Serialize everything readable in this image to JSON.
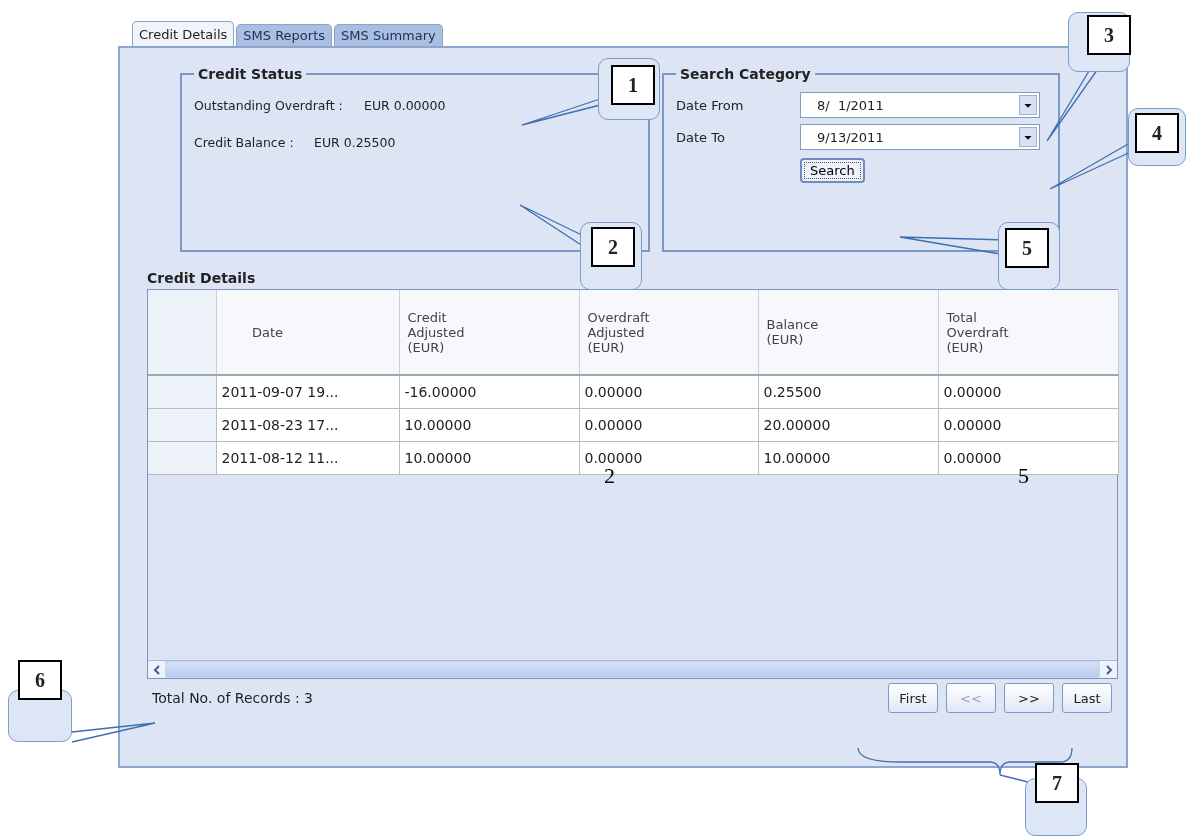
{
  "tabs": [
    {
      "label": "Credit Details",
      "selected": true
    },
    {
      "label": "SMS Reports",
      "selected": false
    },
    {
      "label": "SMS Summary",
      "selected": false
    }
  ],
  "credit_status": {
    "title": "Credit Status",
    "fields": [
      {
        "label": "Outstanding Overdraft :",
        "value": "EUR 0.00000"
      },
      {
        "label": "Credit Balance :",
        "value": "EUR 0.25500"
      }
    ]
  },
  "search_category": {
    "title": "Search Category",
    "fields": [
      {
        "label": "Date From",
        "value": "8/  1/2011"
      },
      {
        "label": "Date To",
        "value": "9/13/2011"
      }
    ],
    "button": "Search"
  },
  "credit_details": {
    "title": "Credit Details",
    "columns": [
      "Date",
      "Credit Adjusted (EUR)",
      "Overdraft Adjusted (EUR)",
      "Balance (EUR)",
      "Total Overdraft (EUR)"
    ],
    "rows": [
      [
        "2011-09-07 19...",
        "-16.00000",
        "0.00000",
        "0.25500",
        "0.00000"
      ],
      [
        "2011-08-23 17...",
        "10.00000",
        "0.00000",
        "20.00000",
        "0.00000"
      ],
      [
        "2011-08-12 11...",
        "10.00000",
        "0.00000",
        "10.00000",
        "0.00000"
      ]
    ]
  },
  "total_records": "Total No. of Records : 3",
  "pager": [
    {
      "label": "First",
      "disabled": false
    },
    {
      "label": "<<",
      "disabled": true
    },
    {
      "label": ">>",
      "disabled": false
    },
    {
      "label": "Last",
      "disabled": false
    }
  ],
  "callouts": [
    "1",
    "2",
    "3",
    "4",
    "5",
    "6",
    "7"
  ],
  "stray_marks": [
    "2",
    "5"
  ]
}
